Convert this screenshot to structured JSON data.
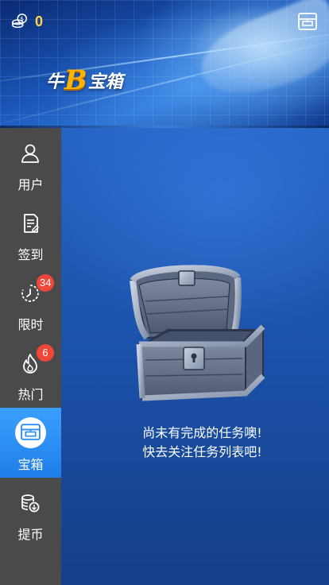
{
  "header": {
    "coin_count": "0",
    "logo": {
      "part1": "牛",
      "part2": "B",
      "part3": "宝箱"
    }
  },
  "sidebar": {
    "items": [
      {
        "label": "用户",
        "icon": "user-icon"
      },
      {
        "label": "签到",
        "icon": "checkin-icon"
      },
      {
        "label": "限时",
        "icon": "timer-icon",
        "badge": "34"
      },
      {
        "label": "热门",
        "icon": "fire-icon",
        "badge": "6"
      },
      {
        "label": "宝箱",
        "icon": "treasure-box-icon",
        "active": true
      },
      {
        "label": "提币",
        "icon": "withdraw-coin-icon"
      }
    ]
  },
  "main": {
    "illustration": "treasure-chest",
    "empty_line1": "尚未有完成的任务噢!",
    "empty_line2": "快去关注任务列表吧!"
  },
  "colors": {
    "accent": "#2b8ef5",
    "badge": "#f0473a",
    "coin": "#ffd54a",
    "sidebar": "#4a4a4a"
  }
}
